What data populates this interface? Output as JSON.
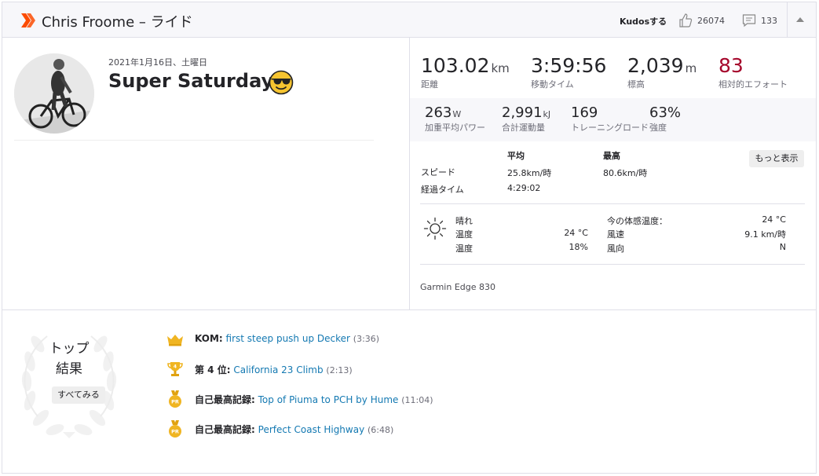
{
  "header": {
    "title": "Chris Froome – ライド",
    "kudos_label": "Kudosする",
    "kudos_count": "26074",
    "comment_count": "133"
  },
  "activity": {
    "date": "2021年1月16日、土曜日",
    "title": "Super Saturday"
  },
  "stats": [
    {
      "value": "103.02",
      "unit": "km",
      "label": "距離"
    },
    {
      "value": "3:59:56",
      "unit": "",
      "label": "移動タイム"
    },
    {
      "value": "2,039",
      "unit": "m",
      "label": "標高"
    },
    {
      "value": "83",
      "unit": "",
      "label": "相対的エフォート"
    }
  ],
  "stats2": [
    {
      "value": "263",
      "unit": "W",
      "label": "加重平均パワー"
    },
    {
      "value": "2,991",
      "unit": "kJ",
      "label": "合計運動量"
    },
    {
      "value": "169",
      "unit": "",
      "label": "トレーニングロード"
    },
    {
      "value": "63%",
      "unit": "",
      "label": "強度"
    }
  ],
  "table": {
    "col_avg": "平均",
    "col_max": "最高",
    "more_label": "もっと表示",
    "rows": [
      {
        "label": "スピード",
        "avg": "25.8km/時",
        "max": "80.6km/時"
      },
      {
        "label": "経過タイム",
        "avg": "4:29:02",
        "max": ""
      }
    ]
  },
  "weather": {
    "condition": "晴れ",
    "temp_label": "温度",
    "temp_value": "24 °C",
    "humidity_label": "温度",
    "humidity_value": "18%",
    "feels_label": "今の体感温度：",
    "feels_value": "24 °C",
    "wind_speed_label": "風速",
    "wind_speed_value": "9.1 km/時",
    "wind_dir_label": "風向",
    "wind_dir_value": "N"
  },
  "device": "Garmin Edge 830",
  "top_results": {
    "title_line1": "トップ",
    "title_line2": "結果",
    "see_all": "すべてみる"
  },
  "achievements": [
    {
      "icon": "crown-icon",
      "prefix": "KOM:",
      "segment": "first steep push up Decker",
      "time": "(3:36)"
    },
    {
      "icon": "trophy-icon",
      "prefix": "第 4 位:",
      "segment": "California 23 Climb",
      "time": "(2:13)"
    },
    {
      "icon": "pr-medal-icon",
      "prefix": "自己最高記録:",
      "segment": "Top of Piuma to PCH by Hume",
      "time": "(11:04)"
    },
    {
      "icon": "pr-medal-icon",
      "prefix": "自己最高記録:",
      "segment": "Perfect Coast Highway",
      "time": "(6:48)"
    }
  ],
  "colors": {
    "brand": "#fc4c02",
    "relative_effort": "#a5062b",
    "link": "#1479b2",
    "gold": "#f0b522"
  }
}
